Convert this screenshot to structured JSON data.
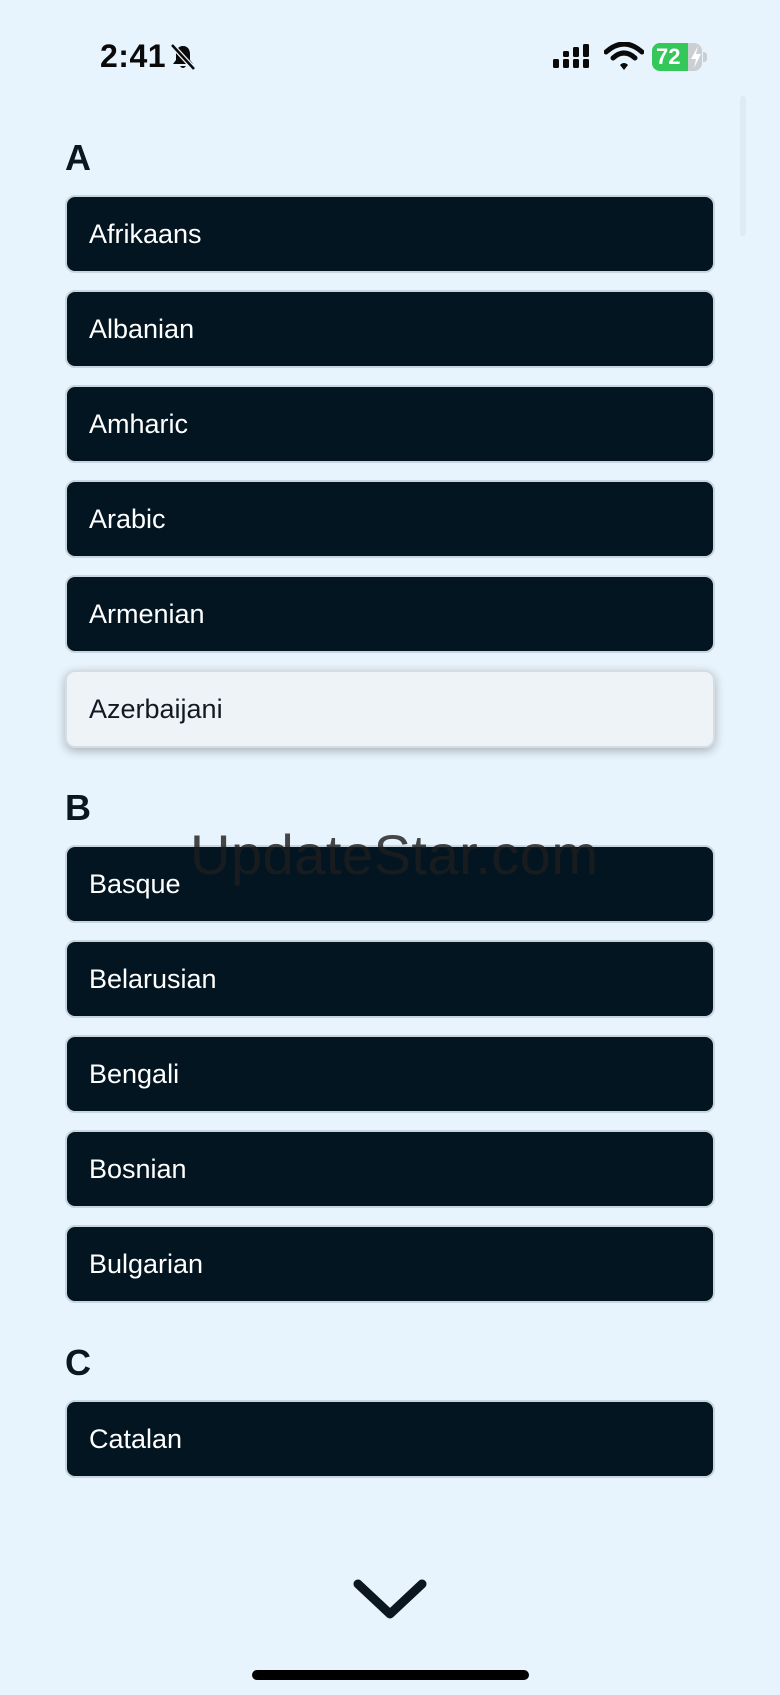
{
  "status_bar": {
    "time": "2:41",
    "battery_level": "72",
    "battery_fraction": 0.72,
    "icons": [
      "bell-slash-icon",
      "cellular-signal-icon",
      "wifi-icon",
      "battery-charging-icon"
    ]
  },
  "sections": [
    {
      "letter": "A",
      "items": [
        {
          "label": "Afrikaans",
          "selected": false
        },
        {
          "label": "Albanian",
          "selected": false
        },
        {
          "label": "Amharic",
          "selected": false
        },
        {
          "label": "Arabic",
          "selected": false
        },
        {
          "label": "Armenian",
          "selected": false
        },
        {
          "label": "Azerbaijani",
          "selected": true
        }
      ]
    },
    {
      "letter": "B",
      "items": [
        {
          "label": "Basque",
          "selected": false
        },
        {
          "label": "Belarusian",
          "selected": false
        },
        {
          "label": "Bengali",
          "selected": false
        },
        {
          "label": "Bosnian",
          "selected": false
        },
        {
          "label": "Bulgarian",
          "selected": false
        }
      ]
    },
    {
      "letter": "C",
      "items": [
        {
          "label": "Catalan",
          "selected": false
        }
      ]
    }
  ],
  "watermark": "UpdateStar.com",
  "footer": {
    "icon": "chevron-down-icon"
  },
  "colors": {
    "background": "#e8f4fd",
    "item_background": "#021521",
    "item_text": "#ffffff",
    "selected_background": "#eef3f8",
    "battery_green": "#34c759"
  }
}
